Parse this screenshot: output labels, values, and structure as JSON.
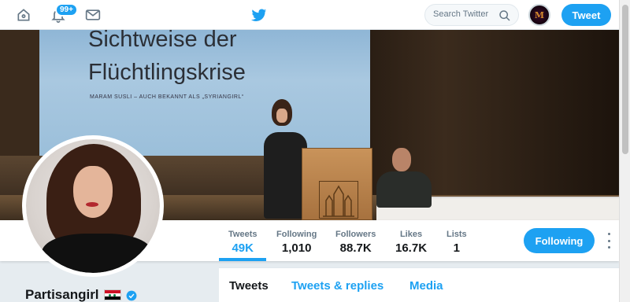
{
  "nav": {
    "notifications_badge": "99+",
    "search_placeholder": "Search Twitter",
    "avatar_monogram": "M",
    "tweet_button": "Tweet"
  },
  "banner": {
    "screen_line1": "Sichtweise der",
    "screen_line2": "Flüchtlingskrise",
    "screen_line3": "MARAM SUSLI – AUCH BEKANNT ALS „SYRIANGIRL“"
  },
  "stats": [
    {
      "label": "Tweets",
      "value": "49K"
    },
    {
      "label": "Following",
      "value": "1,010"
    },
    {
      "label": "Followers",
      "value": "88.7K"
    },
    {
      "label": "Likes",
      "value": "16.7K"
    },
    {
      "label": "Lists",
      "value": "1"
    }
  ],
  "following_button": "Following",
  "profile": {
    "name": "Partisangirl"
  },
  "tabs": [
    "Tweets",
    "Tweets & replies",
    "Media"
  ],
  "colors": {
    "accent": "#1da1f2",
    "text": "#14171a",
    "muted": "#657786",
    "background": "#e6ecf0"
  },
  "icons": {
    "home": "home-icon",
    "notifications": "bell-icon",
    "messages": "envelope-icon",
    "logo": "twitter-bird-icon",
    "search": "search-icon",
    "verified": "verified-badge-icon",
    "more": "more-vertical-icon",
    "flag": "syria-flag-icon"
  }
}
